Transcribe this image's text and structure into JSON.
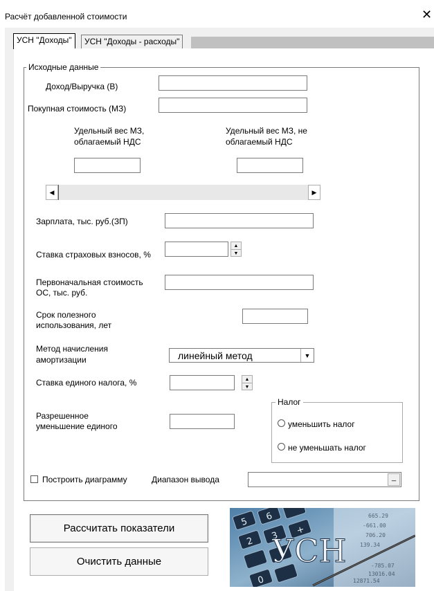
{
  "window": {
    "title": "Расчёт добавленной стоимости",
    "close_glyph": "✕"
  },
  "tabs": [
    {
      "label": "УСН \"Доходы\"",
      "active": true
    },
    {
      "label": "УСН \"Доходы - расходы\"",
      "active": false
    }
  ],
  "frame": {
    "legend": "Исходные данные"
  },
  "fields": {
    "income_label": "Доход/Выручка (В)",
    "income_value": "",
    "purchase_label": "Покупная стоимость (МЗ)",
    "purchase_value": "",
    "vat_share_label_1": "Удельный вес МЗ,",
    "vat_share_label_2": "облагаемый НДС",
    "vat_share_value": "",
    "novat_share_label_1": "Удельный вес МЗ, не",
    "novat_share_label_2": "облагаемый НДС",
    "novat_share_value": "",
    "salary_label": "Зарплата, тыс. руб.(ЗП)",
    "salary_value": "",
    "insurance_label": "Ставка страховых взносов, %",
    "insurance_value": "",
    "initial_cost_label_1": "Первоначальная стоимость",
    "initial_cost_label_2": "ОС, тыс. руб.",
    "initial_cost_value": "",
    "useful_life_label_1": "Срок полезного",
    "useful_life_label_2": "использования, лет",
    "useful_life_value": "",
    "depreciation_label_1": "Метод начисления",
    "depreciation_label_2": "амортизации",
    "depreciation_value": "линейный метод",
    "tax_rate_label": "Ставка единого налога, %",
    "tax_rate_value": "",
    "allowed_reduction_label_1": "Разрешенное",
    "allowed_reduction_label_2": "уменьшение единого",
    "allowed_reduction_value": ""
  },
  "slider": {
    "value": 0
  },
  "tax_group": {
    "legend": "Налог",
    "options": [
      "уменьшить налог",
      "не уменьшать налог"
    ]
  },
  "chart_checkbox": {
    "label": "Построить диаграмму",
    "checked": false
  },
  "output_range": {
    "label": "Диапазон вывода",
    "value": "",
    "button": "_"
  },
  "buttons": {
    "calculate": "Рассчитать показатели",
    "clear": "Очистить данные"
  },
  "image": {
    "text": "УСН"
  },
  "icons": {
    "scroll_left": "◀",
    "scroll_right": "▶",
    "spin_up": "▲",
    "spin_down": "▼",
    "dropdown": "▼"
  },
  "colors": {
    "dialog_bg": "#f0f0f0",
    "page_bg": "#ffffff",
    "border": "#7a7a7a"
  }
}
